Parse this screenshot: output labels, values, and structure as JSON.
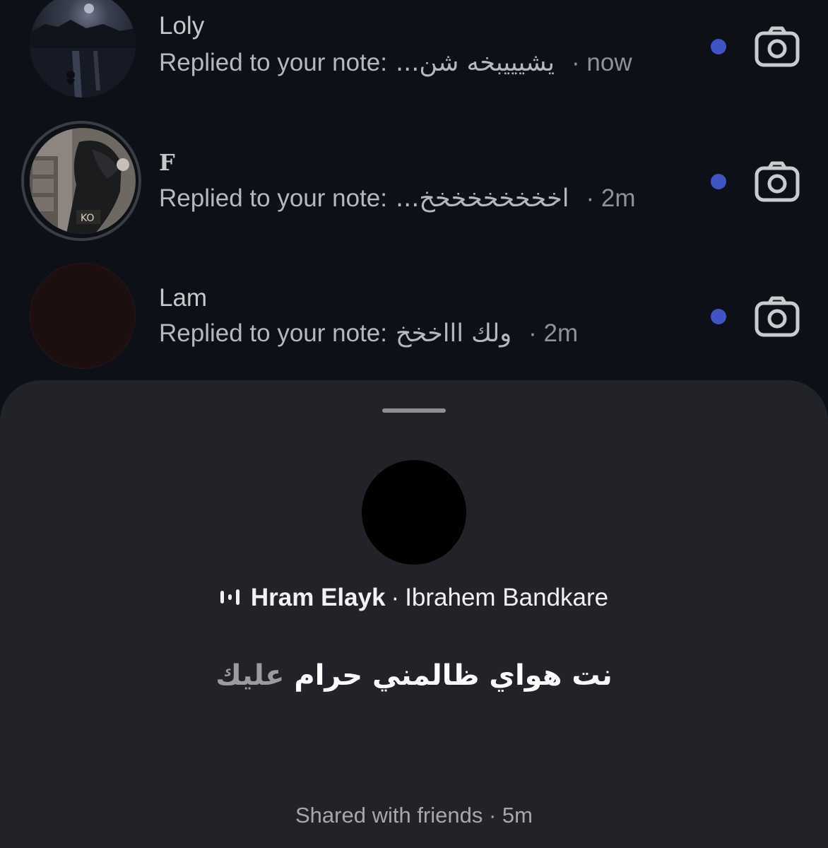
{
  "colors": {
    "background": "#0d1017",
    "sheet": "#222328",
    "unread_dot": "#3f55c6",
    "text_primary": "#c6c8cc",
    "text_secondary": "#8f9298"
  },
  "notifications": [
    {
      "name": "Loly",
      "prefix": "Replied to your note:",
      "message": "يشيييبخه شن...",
      "time": "· now",
      "unread": true,
      "avatar": "night-lake-photo",
      "icon": "camera-icon"
    },
    {
      "name": "F",
      "prefix": "Replied to your note:",
      "message": "اخخخخخخخخخ...",
      "time": "· 2m",
      "unread": true,
      "avatar": "mirror-selfie-photo",
      "icon": "camera-icon"
    },
    {
      "name": "Lam",
      "prefix": "Replied to your note:",
      "message": "ولك اااخخخ",
      "time": "· 2m",
      "unread": true,
      "avatar": "dark-red-avatar",
      "icon": "camera-icon"
    }
  ],
  "note_sheet": {
    "song_icon": "equalizer-icon",
    "song_title": "Hram Elayk",
    "song_separator": "·",
    "song_artist": "Ibrahem Bandkare",
    "note_text_main": "نت هواي ظالمني حرام",
    "note_text_dim": "عليك",
    "shared_label": "Shared with friends · 5m"
  }
}
